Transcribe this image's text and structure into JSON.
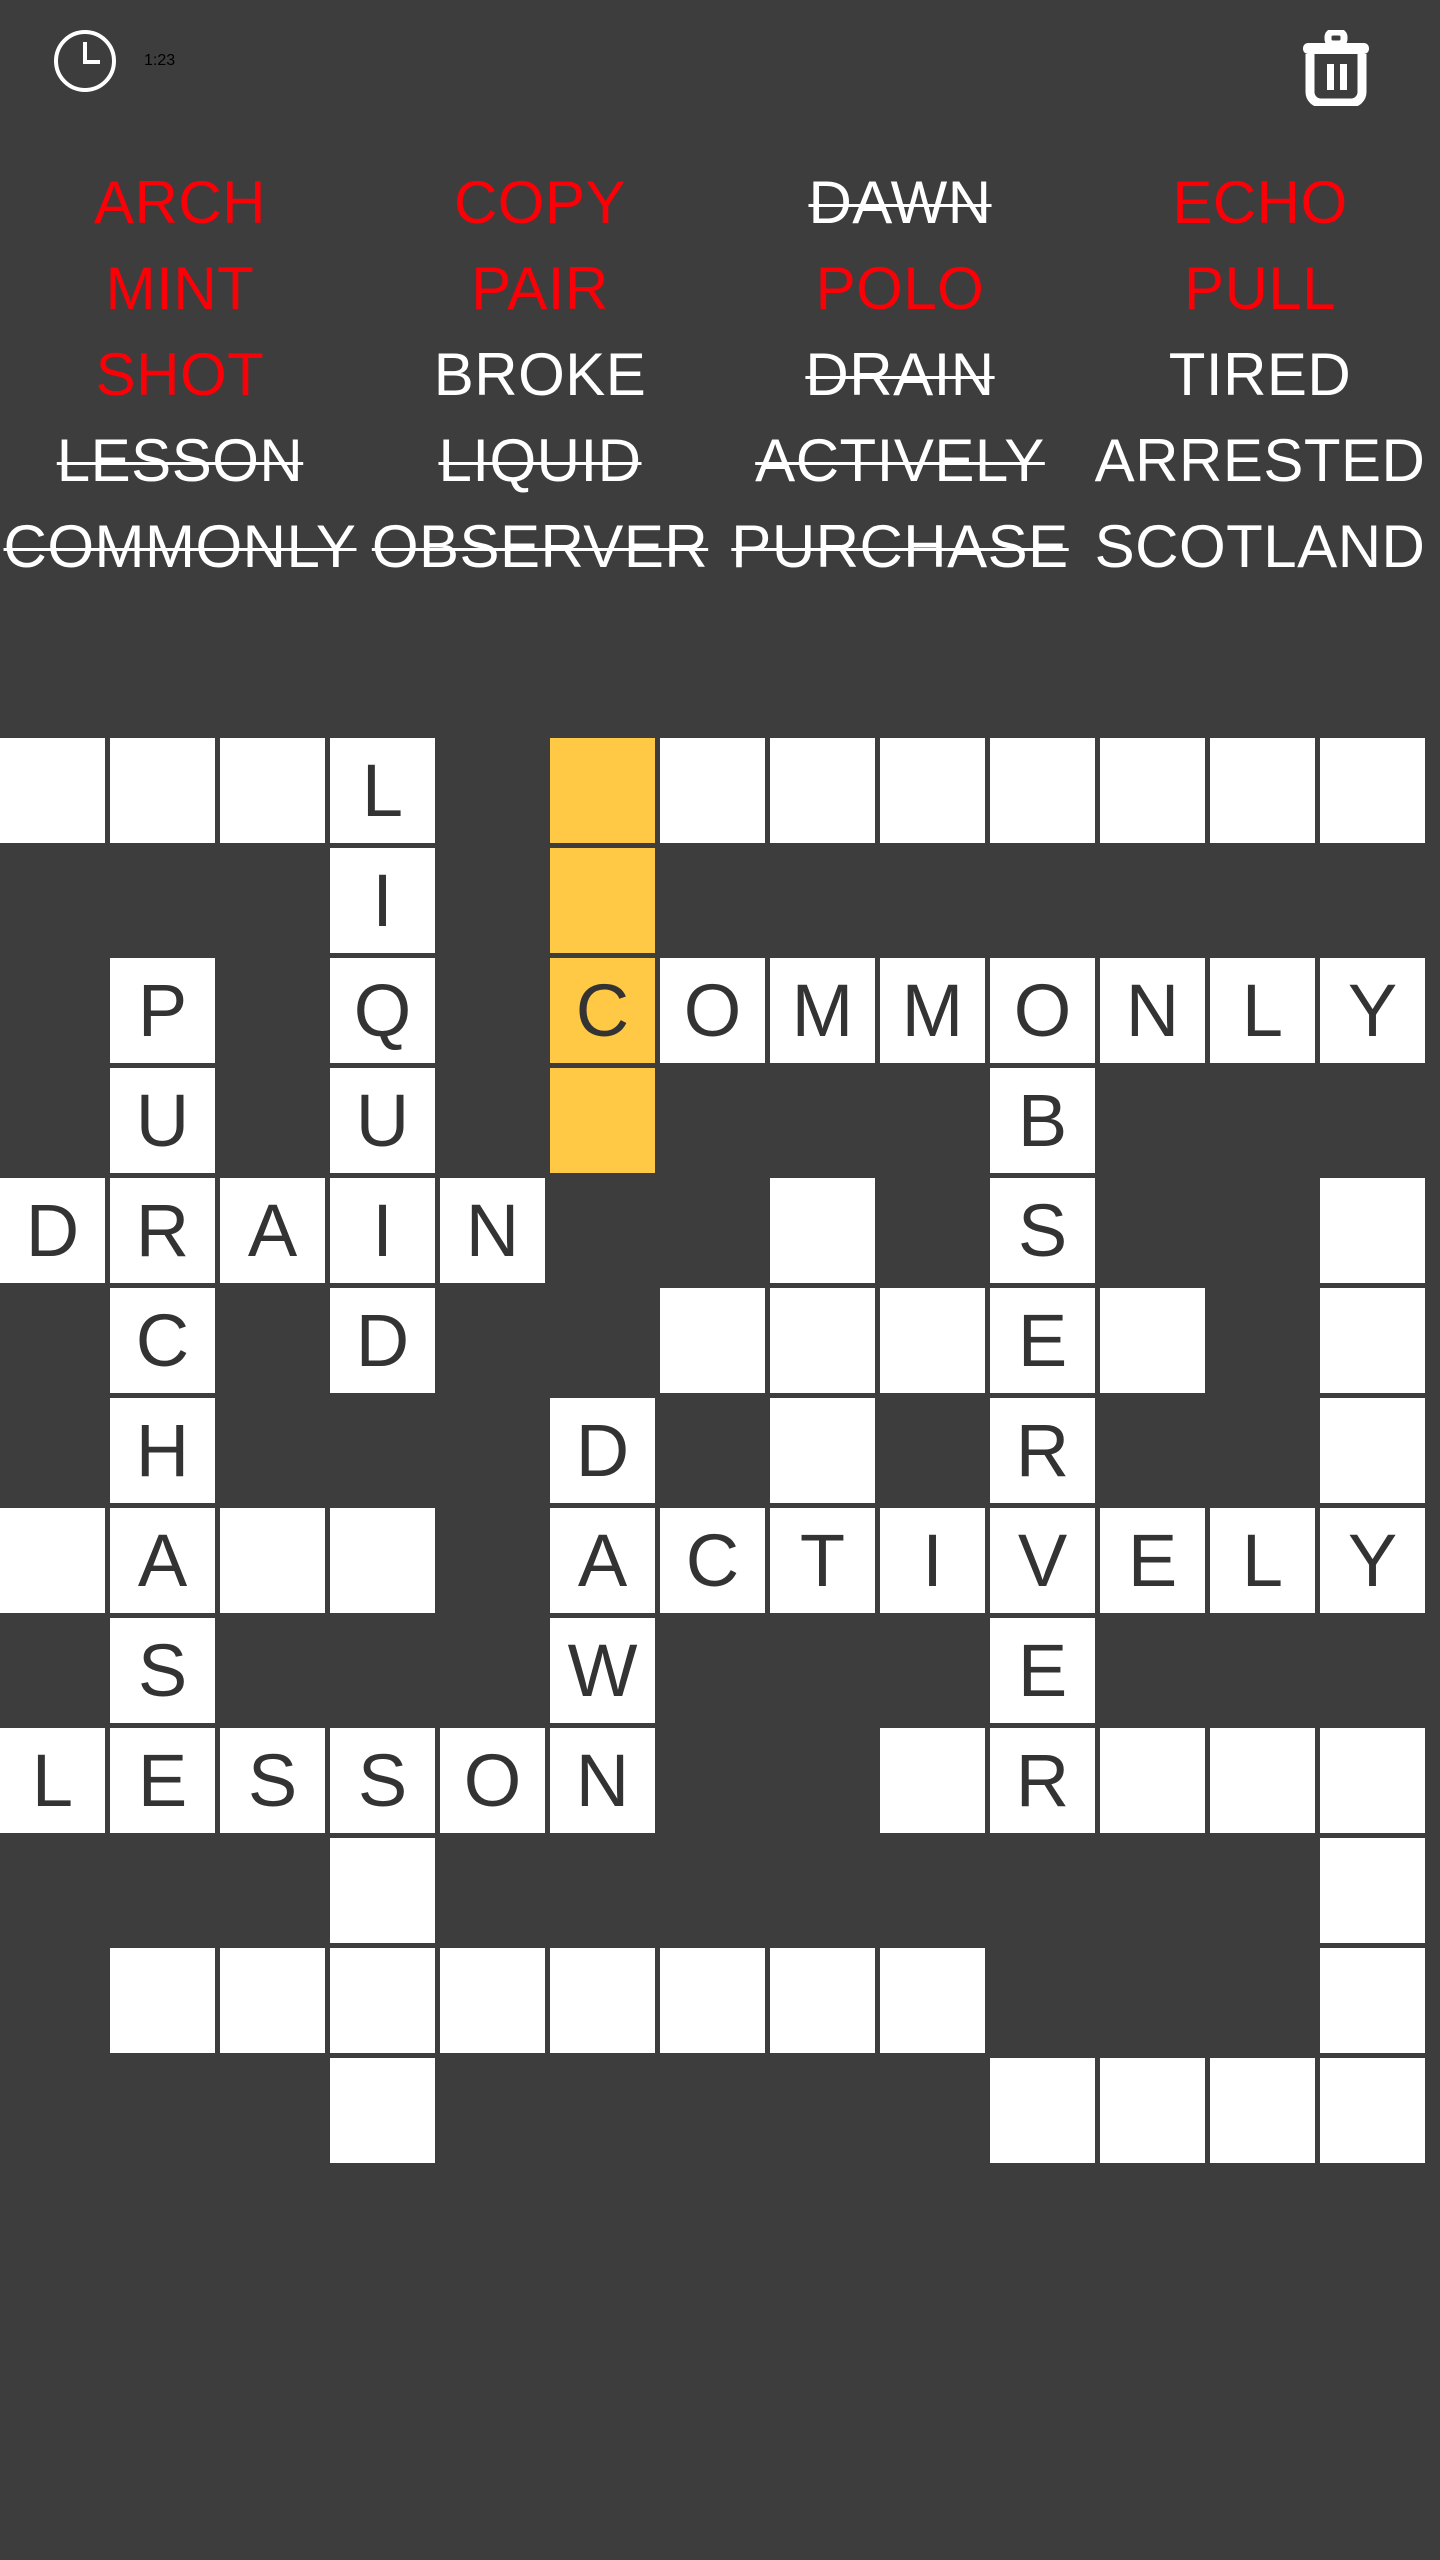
{
  "header": {
    "timer": "1:23",
    "clock_icon": "clock-icon",
    "trash_icon": "trash-icon"
  },
  "colors": {
    "background": "#3d3d3d",
    "cell": "#ffffff",
    "highlight": "#ffc845",
    "letter": "#333333",
    "active_word": "#fb0007",
    "found_word": "#ffffff"
  },
  "wordlist": {
    "columns": 4,
    "words": [
      {
        "text": "ARCH",
        "state": "active"
      },
      {
        "text": "COPY",
        "state": "active"
      },
      {
        "text": "DAWN",
        "state": "found"
      },
      {
        "text": "ECHO",
        "state": "active"
      },
      {
        "text": "MINT",
        "state": "active"
      },
      {
        "text": "PAIR",
        "state": "active"
      },
      {
        "text": "POLO",
        "state": "active"
      },
      {
        "text": "PULL",
        "state": "active"
      },
      {
        "text": "SHOT",
        "state": "active"
      },
      {
        "text": "BROKE",
        "state": "pending"
      },
      {
        "text": "DRAIN",
        "state": "found"
      },
      {
        "text": "TIRED",
        "state": "pending"
      },
      {
        "text": "LESSON",
        "state": "found"
      },
      {
        "text": "LIQUID",
        "state": "found"
      },
      {
        "text": "ACTIVELY",
        "state": "found"
      },
      {
        "text": "ARRESTED",
        "state": "pending"
      },
      {
        "text": "COMMONLY",
        "state": "found"
      },
      {
        "text": "OBSERVER",
        "state": "found"
      },
      {
        "text": "PURCHASE",
        "state": "found"
      },
      {
        "text": "SCOTLAND",
        "state": "pending"
      }
    ]
  },
  "grid": {
    "rows": 13,
    "cols": 13,
    "cell_size": 105,
    "cell_step": 110,
    "cells": [
      {
        "r": 0,
        "c": 0,
        "letter": "",
        "hl": false
      },
      {
        "r": 0,
        "c": 1,
        "letter": "",
        "hl": false
      },
      {
        "r": 0,
        "c": 2,
        "letter": "",
        "hl": false
      },
      {
        "r": 0,
        "c": 3,
        "letter": "L",
        "hl": false
      },
      {
        "r": 0,
        "c": 5,
        "letter": "",
        "hl": true
      },
      {
        "r": 0,
        "c": 6,
        "letter": "",
        "hl": false
      },
      {
        "r": 0,
        "c": 7,
        "letter": "",
        "hl": false
      },
      {
        "r": 0,
        "c": 8,
        "letter": "",
        "hl": false
      },
      {
        "r": 0,
        "c": 9,
        "letter": "",
        "hl": false
      },
      {
        "r": 0,
        "c": 10,
        "letter": "",
        "hl": false
      },
      {
        "r": 0,
        "c": 11,
        "letter": "",
        "hl": false
      },
      {
        "r": 0,
        "c": 12,
        "letter": "",
        "hl": false
      },
      {
        "r": 1,
        "c": 3,
        "letter": "I",
        "hl": false
      },
      {
        "r": 1,
        "c": 5,
        "letter": "",
        "hl": true
      },
      {
        "r": 2,
        "c": 1,
        "letter": "P",
        "hl": false
      },
      {
        "r": 2,
        "c": 3,
        "letter": "Q",
        "hl": false
      },
      {
        "r": 2,
        "c": 5,
        "letter": "C",
        "hl": true
      },
      {
        "r": 2,
        "c": 6,
        "letter": "O",
        "hl": false
      },
      {
        "r": 2,
        "c": 7,
        "letter": "M",
        "hl": false
      },
      {
        "r": 2,
        "c": 8,
        "letter": "M",
        "hl": false
      },
      {
        "r": 2,
        "c": 9,
        "letter": "O",
        "hl": false
      },
      {
        "r": 2,
        "c": 10,
        "letter": "N",
        "hl": false
      },
      {
        "r": 2,
        "c": 11,
        "letter": "L",
        "hl": false
      },
      {
        "r": 2,
        "c": 12,
        "letter": "Y",
        "hl": false
      },
      {
        "r": 3,
        "c": 1,
        "letter": "U",
        "hl": false
      },
      {
        "r": 3,
        "c": 3,
        "letter": "U",
        "hl": false
      },
      {
        "r": 3,
        "c": 5,
        "letter": "",
        "hl": true
      },
      {
        "r": 3,
        "c": 9,
        "letter": "B",
        "hl": false
      },
      {
        "r": 4,
        "c": 0,
        "letter": "D",
        "hl": false
      },
      {
        "r": 4,
        "c": 1,
        "letter": "R",
        "hl": false
      },
      {
        "r": 4,
        "c": 2,
        "letter": "A",
        "hl": false
      },
      {
        "r": 4,
        "c": 3,
        "letter": "I",
        "hl": false
      },
      {
        "r": 4,
        "c": 4,
        "letter": "N",
        "hl": false
      },
      {
        "r": 4,
        "c": 7,
        "letter": "",
        "hl": false
      },
      {
        "r": 4,
        "c": 9,
        "letter": "S",
        "hl": false
      },
      {
        "r": 4,
        "c": 12,
        "letter": "",
        "hl": false
      },
      {
        "r": 5,
        "c": 1,
        "letter": "C",
        "hl": false
      },
      {
        "r": 5,
        "c": 3,
        "letter": "D",
        "hl": false
      },
      {
        "r": 5,
        "c": 6,
        "letter": "",
        "hl": false
      },
      {
        "r": 5,
        "c": 7,
        "letter": "",
        "hl": false
      },
      {
        "r": 5,
        "c": 8,
        "letter": "",
        "hl": false
      },
      {
        "r": 5,
        "c": 9,
        "letter": "E",
        "hl": false
      },
      {
        "r": 5,
        "c": 10,
        "letter": "",
        "hl": false
      },
      {
        "r": 5,
        "c": 12,
        "letter": "",
        "hl": false
      },
      {
        "r": 6,
        "c": 1,
        "letter": "H",
        "hl": false
      },
      {
        "r": 6,
        "c": 5,
        "letter": "D",
        "hl": false
      },
      {
        "r": 6,
        "c": 7,
        "letter": "",
        "hl": false
      },
      {
        "r": 6,
        "c": 9,
        "letter": "R",
        "hl": false
      },
      {
        "r": 6,
        "c": 12,
        "letter": "",
        "hl": false
      },
      {
        "r": 7,
        "c": 0,
        "letter": "",
        "hl": false
      },
      {
        "r": 7,
        "c": 1,
        "letter": "A",
        "hl": false
      },
      {
        "r": 7,
        "c": 2,
        "letter": "",
        "hl": false
      },
      {
        "r": 7,
        "c": 3,
        "letter": "",
        "hl": false
      },
      {
        "r": 7,
        "c": 5,
        "letter": "A",
        "hl": false
      },
      {
        "r": 7,
        "c": 6,
        "letter": "C",
        "hl": false
      },
      {
        "r": 7,
        "c": 7,
        "letter": "T",
        "hl": false
      },
      {
        "r": 7,
        "c": 8,
        "letter": "I",
        "hl": false
      },
      {
        "r": 7,
        "c": 9,
        "letter": "V",
        "hl": false
      },
      {
        "r": 7,
        "c": 10,
        "letter": "E",
        "hl": false
      },
      {
        "r": 7,
        "c": 11,
        "letter": "L",
        "hl": false
      },
      {
        "r": 7,
        "c": 12,
        "letter": "Y",
        "hl": false
      },
      {
        "r": 8,
        "c": 1,
        "letter": "S",
        "hl": false
      },
      {
        "r": 8,
        "c": 5,
        "letter": "W",
        "hl": false
      },
      {
        "r": 8,
        "c": 9,
        "letter": "E",
        "hl": false
      },
      {
        "r": 9,
        "c": 0,
        "letter": "L",
        "hl": false
      },
      {
        "r": 9,
        "c": 1,
        "letter": "E",
        "hl": false
      },
      {
        "r": 9,
        "c": 2,
        "letter": "S",
        "hl": false
      },
      {
        "r": 9,
        "c": 3,
        "letter": "S",
        "hl": false
      },
      {
        "r": 9,
        "c": 4,
        "letter": "O",
        "hl": false
      },
      {
        "r": 9,
        "c": 5,
        "letter": "N",
        "hl": false
      },
      {
        "r": 9,
        "c": 8,
        "letter": "",
        "hl": false
      },
      {
        "r": 9,
        "c": 9,
        "letter": "R",
        "hl": false
      },
      {
        "r": 9,
        "c": 10,
        "letter": "",
        "hl": false
      },
      {
        "r": 9,
        "c": 11,
        "letter": "",
        "hl": false
      },
      {
        "r": 9,
        "c": 12,
        "letter": "",
        "hl": false
      },
      {
        "r": 10,
        "c": 3,
        "letter": "",
        "hl": false
      },
      {
        "r": 10,
        "c": 12,
        "letter": "",
        "hl": false
      },
      {
        "r": 11,
        "c": 1,
        "letter": "",
        "hl": false
      },
      {
        "r": 11,
        "c": 2,
        "letter": "",
        "hl": false
      },
      {
        "r": 11,
        "c": 3,
        "letter": "",
        "hl": false
      },
      {
        "r": 11,
        "c": 4,
        "letter": "",
        "hl": false
      },
      {
        "r": 11,
        "c": 5,
        "letter": "",
        "hl": false
      },
      {
        "r": 11,
        "c": 6,
        "letter": "",
        "hl": false
      },
      {
        "r": 11,
        "c": 7,
        "letter": "",
        "hl": false
      },
      {
        "r": 11,
        "c": 8,
        "letter": "",
        "hl": false
      },
      {
        "r": 11,
        "c": 12,
        "letter": "",
        "hl": false
      },
      {
        "r": 12,
        "c": 3,
        "letter": "",
        "hl": false
      },
      {
        "r": 12,
        "c": 9,
        "letter": "",
        "hl": false
      },
      {
        "r": 12,
        "c": 10,
        "letter": "",
        "hl": false
      },
      {
        "r": 12,
        "c": 11,
        "letter": "",
        "hl": false
      },
      {
        "r": 12,
        "c": 12,
        "letter": "",
        "hl": false
      }
    ]
  }
}
